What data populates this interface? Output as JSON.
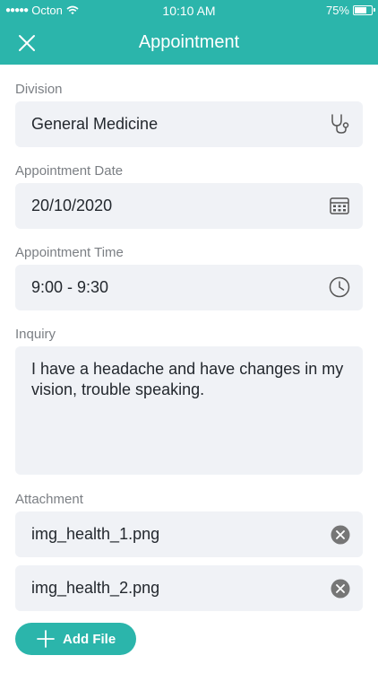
{
  "status_bar": {
    "carrier": "Octon",
    "time": "10:10 AM",
    "battery": "75%",
    "battery_level": 0.75
  },
  "header": {
    "title": "Appointment"
  },
  "form": {
    "division": {
      "label": "Division",
      "value": "General Medicine",
      "icon": "stethoscope-icon"
    },
    "date": {
      "label": "Appointment Date",
      "value": "20/10/2020",
      "icon": "calendar-icon"
    },
    "time": {
      "label": "Appointment Time",
      "value": "9:00 - 9:30",
      "icon": "clock-icon"
    },
    "inquiry": {
      "label": "Inquiry",
      "value": "I have a headache and have changes in my vision, trouble speaking."
    },
    "attachment": {
      "label": "Attachment",
      "files": [
        {
          "name": "img_health_1.png"
        },
        {
          "name": "img_health_2.png"
        }
      ],
      "add_label": "Add File"
    }
  },
  "colors": {
    "accent": "#2bb5ab",
    "field_bg": "#f0f2f6",
    "label": "#7b7f84",
    "text": "#23282e"
  }
}
